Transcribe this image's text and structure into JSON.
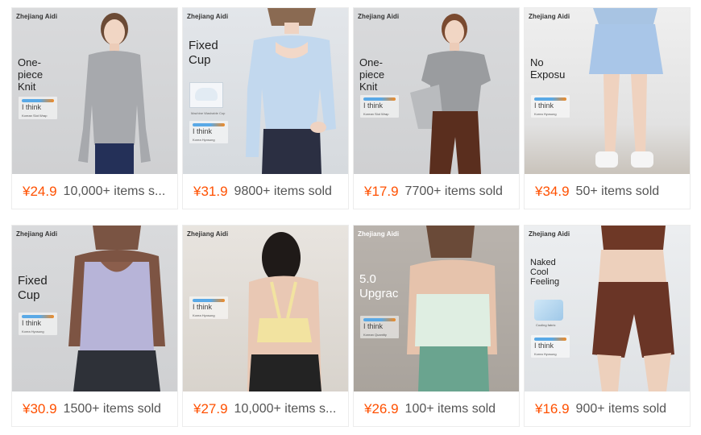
{
  "products": [
    {
      "brand": "Zhejiang Aidi",
      "headline": "One-piece Knit",
      "logo_text": "I think",
      "logo_sub": "Korean Slot Wrap",
      "price": "¥24.9",
      "sold": "10,000+ items s..."
    },
    {
      "brand": "Zhejiang Aidi",
      "headline": "Fixed Cup",
      "fabric_caption": "Machine Washable Cup",
      "logo_text": "I think",
      "logo_sub": "Korea Hyosung",
      "price": "¥31.9",
      "sold": "9800+ items sold"
    },
    {
      "brand": "Zhejiang Aidi",
      "headline": "One-piece Knit",
      "logo_text": "I think",
      "logo_sub": "Korean Slot Wrap",
      "price": "¥17.9",
      "sold": "7700+ items sold"
    },
    {
      "brand": "Zhejiang Aidi",
      "headline": "No Exposu",
      "logo_text": "I think",
      "logo_sub": "Korea Hyosung",
      "price": "¥34.9",
      "sold": "50+ items sold"
    },
    {
      "brand": "Zhejiang Aidi",
      "headline": "Fixed Cup",
      "logo_text": "I think",
      "logo_sub": "Korea Hyosung",
      "price": "¥30.9",
      "sold": "1500+ items sold"
    },
    {
      "brand": "Zhejiang Aidi",
      "headline": "",
      "logo_text": "I think",
      "logo_sub": "Korea Hyosung",
      "price": "¥27.9",
      "sold": "10,000+ items s..."
    },
    {
      "brand": "Zhejiang Aidi",
      "headline": "5.0 Upgrac",
      "logo_text": "I think",
      "logo_sub": "Korean Quantity",
      "price": "¥26.9",
      "sold": "100+ items sold"
    },
    {
      "brand": "Zhejiang Aidi",
      "headline": "Naked Cool Feeling",
      "cool_caption": "Cooling fabric",
      "logo_text": "I think",
      "logo_sub": "Korea Hyosung",
      "price": "¥16.9",
      "sold": "900+ items sold"
    }
  ],
  "colors": {
    "price": "#ff5000",
    "sold": "#555555",
    "card_border": "#ececec"
  }
}
